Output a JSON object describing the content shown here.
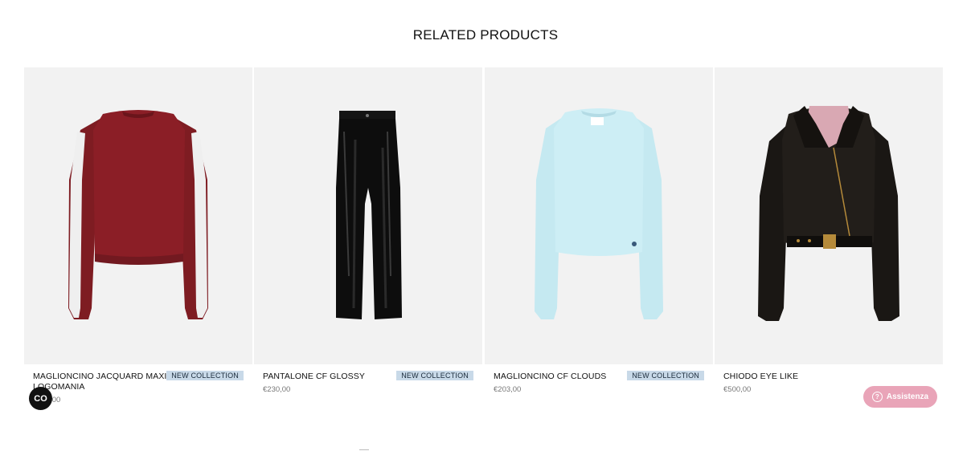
{
  "section": {
    "title": "RELATED PRODUCTS"
  },
  "products": [
    {
      "name": "MAGLIONCINO JACQUARD MAXI LOGOMANIA",
      "badge": "NEW COLLECTION",
      "price": "€203,00",
      "image": "burgundy-sweater-image"
    },
    {
      "name": "PANTALONE CF GLOSSY",
      "badge": "NEW COLLECTION",
      "price": "€230,00",
      "image": "black-glossy-trousers-image"
    },
    {
      "name": "MAGLIONCINO CF CLOUDS",
      "badge": "NEW COLLECTION",
      "price": "€203,00",
      "image": "light-blue-sweater-image"
    },
    {
      "name": "CHIODO EYE LIKE",
      "badge": "",
      "price": "€500,00",
      "image": "black-leather-jacket-image"
    }
  ],
  "widgets": {
    "cookie_label": "CO",
    "assist_label": "Assistenza"
  },
  "colors": {
    "badge_bg": "#c8d9e8",
    "assist_bg": "#e9a4b8",
    "card_bg": "#f2f2f2"
  }
}
